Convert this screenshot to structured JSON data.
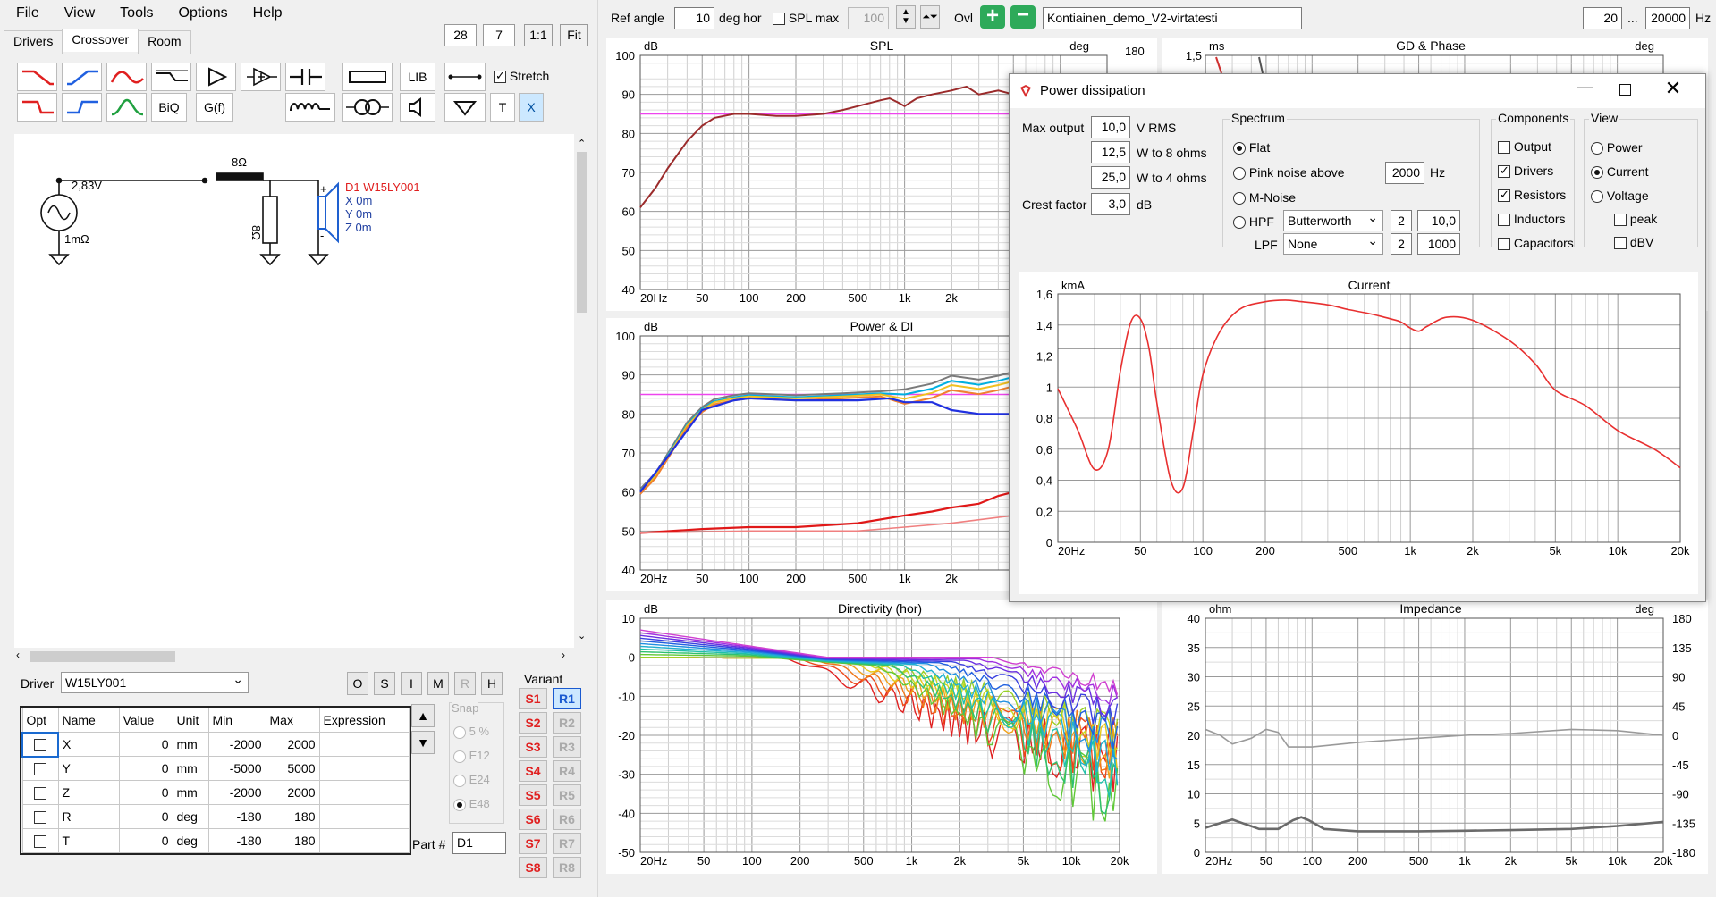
{
  "menu": [
    "File",
    "View",
    "Tools",
    "Options",
    "Help"
  ],
  "tabs": [
    "Drivers",
    "Crossover",
    "Room"
  ],
  "zoom": {
    "a": "28",
    "b": "7",
    "one": "1:1",
    "fit": "Fit"
  },
  "toolbar": {
    "lib": "LIB",
    "stretch": "Stretch",
    "biq": "BiQ",
    "gf": "G(f)",
    "t": "T",
    "x": "X"
  },
  "schematic": {
    "voltage": "2,83V",
    "rs": "1mΩ",
    "r_series": "8Ω",
    "r_shunt": "8Ω",
    "plus": "+",
    "minus": "-",
    "driver": "D1 W15LY001",
    "dx": "X 0m",
    "dy": "Y 0m",
    "dz": "Z 0m"
  },
  "driver_row": {
    "label": "Driver",
    "value": "W15LY001",
    "buttons": [
      "O",
      "S",
      "I",
      "M",
      "R",
      "H"
    ]
  },
  "params": {
    "headers": [
      "Opt",
      "Name",
      "Value",
      "Unit",
      "Min",
      "Max",
      "Expression"
    ],
    "rows": [
      [
        "X",
        "0",
        "mm",
        "-2000",
        "2000"
      ],
      [
        "Y",
        "0",
        "mm",
        "-5000",
        "5000"
      ],
      [
        "Z",
        "0",
        "mm",
        "-2000",
        "2000"
      ],
      [
        "R",
        "0",
        "deg",
        "-180",
        "180"
      ],
      [
        "T",
        "0",
        "deg",
        "-180",
        "180"
      ]
    ]
  },
  "snap": {
    "label": "Snap",
    "options": [
      "5 %",
      "E12",
      "E24",
      "E48"
    ]
  },
  "variant": {
    "label": "Variant",
    "s": [
      "S1",
      "S2",
      "S3",
      "S4",
      "S5",
      "S6",
      "S7",
      "S8"
    ],
    "r": [
      "R1",
      "R2",
      "R3",
      "R4",
      "R5",
      "R6",
      "R7",
      "R8"
    ]
  },
  "part": {
    "label": "Part #",
    "value": "D1"
  },
  "topbar": {
    "ref_angle_label": "Ref angle",
    "ref_angle": "10",
    "deg_hor": "deg hor",
    "spl_max_label": "SPL max",
    "spl_max": "100",
    "ovl": "Ovl",
    "project": "Kontiainen_demo_V2-virtatesti",
    "f_min": "20",
    "dots": "...",
    "f_max": "20000",
    "hz": "Hz"
  },
  "graphs": {
    "spl": {
      "title": "SPL",
      "unit_l": "dB",
      "unit_r": "deg",
      "r_top": "180",
      "yticks": [
        "100",
        "90",
        "80",
        "70",
        "60",
        "50",
        "40"
      ],
      "xticks": [
        "20Hz",
        "50",
        "100",
        "200",
        "500",
        "1k",
        "2k"
      ]
    },
    "gd": {
      "title": "GD & Phase",
      "unit_l": "ms",
      "unit_r": "deg",
      "y_top": "1,5"
    },
    "power": {
      "title": "Power & DI",
      "unit_l": "dB",
      "yticks": [
        "100",
        "90",
        "80",
        "70",
        "60",
        "50",
        "40"
      ],
      "xticks": [
        "20Hz",
        "50",
        "100",
        "200",
        "500",
        "1k",
        "2k"
      ]
    },
    "dir": {
      "title": "Directivity (hor)",
      "unit_l": "dB",
      "yticks": [
        "10",
        "0",
        "-10",
        "-20",
        "-30",
        "-40",
        "-50"
      ],
      "xticks": [
        "20Hz",
        "50",
        "100",
        "200",
        "500",
        "1k",
        "2k",
        "5k",
        "10k",
        "20k"
      ]
    },
    "imp": {
      "title": "Impedance",
      "unit_l": "ohm",
      "unit_r": "deg",
      "yticks": [
        "40",
        "35",
        "30",
        "25",
        "20",
        "15",
        "10",
        "5",
        "0"
      ],
      "rticks": [
        "180",
        "135",
        "90",
        "45",
        "0",
        "-45",
        "-90",
        "-135",
        "-180"
      ],
      "xticks": [
        "20Hz",
        "50",
        "100",
        "200",
        "500",
        "1k",
        "2k",
        "5k",
        "10k",
        "20k"
      ]
    }
  },
  "dialog": {
    "title": "Power dissipation",
    "max_output_label": "Max output",
    "max_output": "10,0",
    "v_rms": "V  RMS",
    "w8": "12,5",
    "w8_label": "W to 8 ohms",
    "w4": "25,0",
    "w4_label": "W to 4 ohms",
    "crest_label": "Crest factor",
    "crest": "3,0",
    "db": "dB",
    "spectrum": {
      "label": "Spectrum",
      "flat": "Flat",
      "pink": "Pink noise above",
      "pink_val": "2000",
      "hz": "Hz",
      "mnoise": "M-Noise",
      "hpf": "HPF",
      "hpf_type": "Butterworth",
      "hpf_order": "2",
      "hpf_freq": "10,0",
      "lpf": "LPF",
      "lpf_type": "None",
      "lpf_order": "2",
      "lpf_freq": "1000"
    },
    "components": {
      "label": "Components",
      "items": [
        "Output",
        "Drivers",
        "Resistors",
        "Inductors",
        "Capacitors"
      ]
    },
    "view": {
      "label": "View",
      "items": [
        "Power",
        "Current",
        "Voltage"
      ],
      "peak": "peak",
      "dbv": "dBV"
    },
    "chart": {
      "title": "Current",
      "unit": "kmA",
      "yticks": [
        "1,6",
        "1,4",
        "1,2",
        "1",
        "0,8",
        "0,6",
        "0,4",
        "0,2",
        "0"
      ],
      "xticks": [
        "20Hz",
        "50",
        "100",
        "200",
        "500",
        "1k",
        "2k",
        "5k",
        "10k",
        "20k"
      ]
    }
  },
  "chart_data": {
    "type": "line",
    "title": "Current",
    "xlabel": "",
    "ylabel": "kmA",
    "xscale": "log",
    "xlim": [
      20,
      20000
    ],
    "ylim": [
      0,
      1.6
    ],
    "series": [
      {
        "x": [
          20,
          25,
          30,
          35,
          40,
          45,
          50,
          55,
          60,
          70,
          80,
          90,
          100,
          120,
          150,
          200,
          250,
          300,
          400,
          500,
          600,
          700,
          800,
          900,
          1000,
          1100,
          1200,
          1500,
          2000,
          3000,
          4000,
          5000,
          7000,
          10000,
          15000,
          20000
        ],
        "y": [
          0.99,
          0.72,
          0.47,
          0.6,
          1.1,
          1.42,
          1.44,
          1.25,
          0.9,
          0.4,
          0.35,
          0.72,
          1.08,
          1.35,
          1.5,
          1.55,
          1.56,
          1.55,
          1.53,
          1.5,
          1.48,
          1.46,
          1.44,
          1.42,
          1.38,
          1.36,
          1.39,
          1.45,
          1.43,
          1.3,
          1.15,
          0.98,
          0.88,
          0.72,
          0.6,
          0.48
        ]
      }
    ]
  }
}
